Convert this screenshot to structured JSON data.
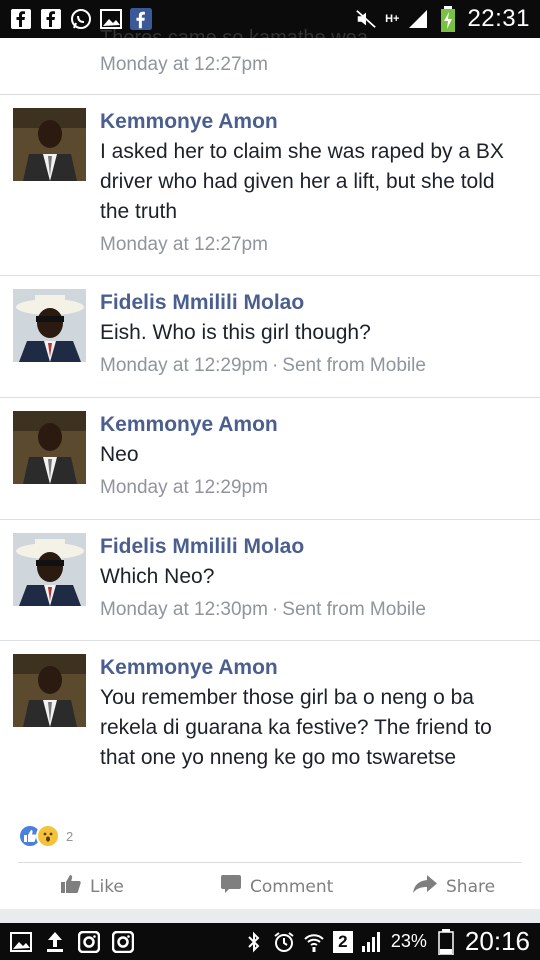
{
  "status_top": {
    "time": "22:31",
    "network": "H+"
  },
  "feed": {
    "truncated_top_text": "Theres came so kamathe wea",
    "messages": [
      {
        "author": "",
        "text": "",
        "timestamp": "Monday at 12:27pm",
        "via": ""
      },
      {
        "author": "Kemmonye Amon",
        "text": "I asked her to claim she was raped by a BX driver who had given her a lift, but she told the truth",
        "timestamp": "Monday at 12:27pm",
        "via": ""
      },
      {
        "author": "Fidelis Mmilili Molao",
        "text": "Eish. Who is this girl though?",
        "timestamp": "Monday at 12:29pm",
        "via": "Sent from Mobile"
      },
      {
        "author": "Kemmonye Amon",
        "text": "Neo",
        "timestamp": "Monday at 12:29pm",
        "via": ""
      },
      {
        "author": "Fidelis Mmilili Molao",
        "text": "Which Neo?",
        "timestamp": "Monday at 12:30pm",
        "via": "Sent from Mobile"
      },
      {
        "author": "Kemmonye Amon",
        "text": "You remember those girl ba o neng o ba rekela di guarana ka festive? The friend to that one yo nneng ke go mo tswaretse",
        "timestamp": "",
        "via": ""
      }
    ]
  },
  "reactions": {
    "count": "2",
    "icons": [
      "like-reaction-icon",
      "wow-reaction-icon"
    ]
  },
  "actions": {
    "like": "Like",
    "comment": "Comment",
    "share": "Share"
  },
  "status_bottom": {
    "battery": "23%",
    "time": "20:16",
    "notification_count": "2"
  },
  "colors": {
    "author": "#4b5f8f",
    "meta": "#90949c",
    "bar": "#0b0b0b"
  }
}
